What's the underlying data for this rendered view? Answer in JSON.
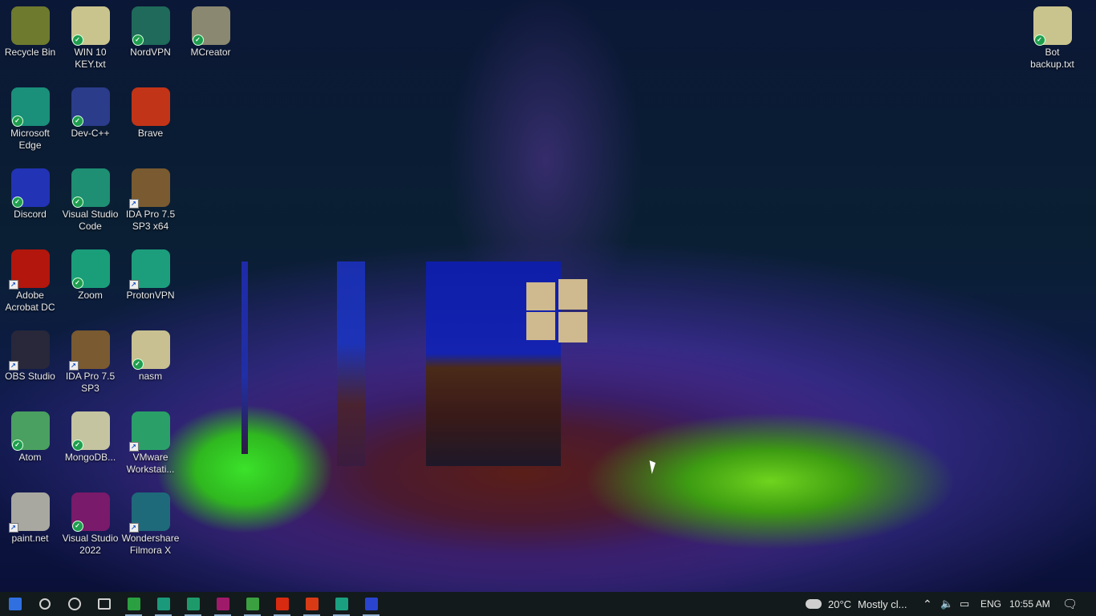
{
  "desktop": {
    "icons": [
      {
        "label": "Recycle Bin",
        "icon": "recycle-bin-icon",
        "color": "#6e7a2e"
      },
      {
        "label": "WIN 10\nKEY.txt",
        "icon": "text-file-icon",
        "color": "#c9c48e"
      },
      {
        "label": "NordVPN",
        "icon": "nordvpn-icon",
        "color": "#1f6a5a"
      },
      {
        "label": "MCreator",
        "icon": "mcreator-icon",
        "color": "#8a8870"
      },
      {
        "label": "Bot\nbackup.txt",
        "icon": "text-file-icon",
        "color": "#c9c48e"
      },
      {
        "label": "Microsoft\nEdge",
        "icon": "edge-icon",
        "color": "#1a8f7a"
      },
      {
        "label": "Dev-C++",
        "icon": "devcpp-icon",
        "color": "#2a3c8a"
      },
      {
        "label": "Brave",
        "icon": "brave-icon",
        "color": "#c23417"
      },
      {
        "label": "Discord",
        "icon": "discord-icon",
        "color": "#2233b5"
      },
      {
        "label": "Visual Studio\nCode",
        "icon": "vscode-icon",
        "color": "#1e8f72"
      },
      {
        "label": "IDA Pro 7.5\nSP3 x64",
        "icon": "ida-icon",
        "color": "#7a5a30"
      },
      {
        "label": "Adobe\nAcrobat DC",
        "icon": "acrobat-icon",
        "color": "#b2160c"
      },
      {
        "label": "Zoom",
        "icon": "zoom-icon",
        "color": "#1a9e7a"
      },
      {
        "label": "ProtonVPN",
        "icon": "protonvpn-icon",
        "color": "#1c9e7c"
      },
      {
        "label": "OBS Studio",
        "icon": "obs-icon",
        "color": "#28283a"
      },
      {
        "label": "IDA Pro 7.5\nSP3",
        "icon": "ida-icon",
        "color": "#7a5a30"
      },
      {
        "label": "nasm",
        "icon": "nasm-icon",
        "color": "#c8c090"
      },
      {
        "label": "Atom",
        "icon": "atom-icon",
        "color": "#4aa060"
      },
      {
        "label": "MongoDB...",
        "icon": "mongodb-icon",
        "color": "#c4c4a0"
      },
      {
        "label": "VMware\nWorkstati...",
        "icon": "vmware-icon",
        "color": "#2aa068"
      },
      {
        "label": "paint.net",
        "icon": "paintnet-icon",
        "color": "#a8a8a0"
      },
      {
        "label": "Visual Studio\n2022",
        "icon": "visual-studio-icon",
        "color": "#7a1a6a"
      },
      {
        "label": "Wondershare\nFilmora X",
        "icon": "filmora-icon",
        "color": "#1e6a7a"
      }
    ]
  },
  "taskbar": {
    "apps": [
      {
        "name": "start-button",
        "icon": "windows-icon",
        "color": "#2f6fe0"
      },
      {
        "name": "search-button",
        "icon": "search-icon",
        "color": "#d0d0d0"
      },
      {
        "name": "cortana-button",
        "icon": "cortana-icon",
        "color": "#d0d0d0"
      },
      {
        "name": "task-view-button",
        "icon": "task-view-icon",
        "color": "#d0d0d0"
      },
      {
        "name": "store-app",
        "icon": "store-icon",
        "color": "#2aa040"
      },
      {
        "name": "edge-app",
        "icon": "edge-icon",
        "color": "#1a9a7a"
      },
      {
        "name": "vscode-app",
        "icon": "vscode-icon",
        "color": "#1e9a6a"
      },
      {
        "name": "visual-studio-app",
        "icon": "visual-studio-icon",
        "color": "#a01a6a"
      },
      {
        "name": "file-explorer-app",
        "icon": "folder-icon",
        "color": "#3aa040"
      },
      {
        "name": "office-app",
        "icon": "office-icon",
        "color": "#d82a10"
      },
      {
        "name": "brave-app",
        "icon": "brave-icon",
        "color": "#d83a16"
      },
      {
        "name": "zoom-app",
        "icon": "zoom-icon",
        "color": "#1aa080"
      },
      {
        "name": "discord-app",
        "icon": "discord-icon",
        "color": "#2a44d0"
      }
    ],
    "weather": {
      "temp": "20°C",
      "text": "Mostly cl..."
    },
    "language": "ENG",
    "time": "10:55 AM"
  }
}
